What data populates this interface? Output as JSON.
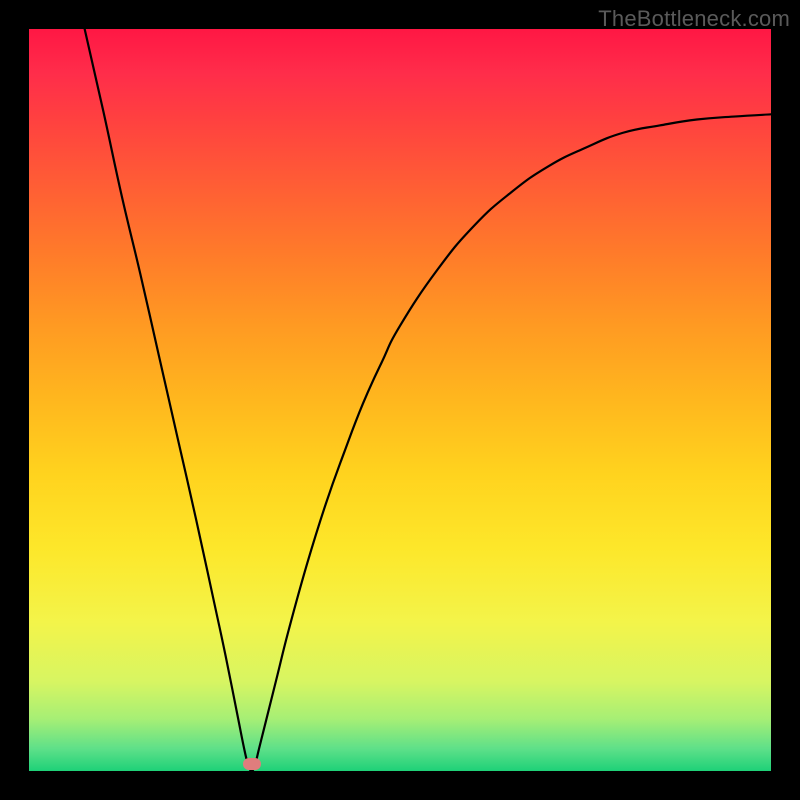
{
  "watermark": "TheBottleneck.com",
  "chart_data": {
    "type": "line",
    "title": "",
    "xlabel": "",
    "ylabel": "",
    "xlim": [
      0,
      100
    ],
    "ylim": [
      0,
      100
    ],
    "series": [
      {
        "name": "curve",
        "x": [
          7.5,
          10,
          12.5,
          15,
          17.5,
          20,
          22.5,
          25,
          26.5,
          28,
          29,
          29.5,
          30.0,
          30.5,
          31,
          32,
          33.5,
          35,
          37.5,
          40,
          42.5,
          45,
          47.5,
          50,
          55,
          60,
          65,
          70,
          75,
          80,
          85,
          90,
          95,
          100
        ],
        "y": [
          100,
          89,
          77.5,
          67,
          56,
          45,
          34,
          22.5,
          15.5,
          8,
          3,
          1,
          0.0,
          1,
          3,
          7,
          13,
          19,
          28,
          36,
          43,
          49.5,
          55,
          60,
          67.5,
          73.5,
          78,
          81.5,
          84,
          86,
          87,
          87.8,
          88.2,
          88.5
        ]
      }
    ],
    "marker": {
      "x": 30.0,
      "y": 0.9
    },
    "colors": {
      "curve": "#000000",
      "marker": "#df7d7d",
      "gradient_top": "#ff1744",
      "gradient_mid": "#ffd31e",
      "gradient_bottom": "#1ed178"
    }
  }
}
